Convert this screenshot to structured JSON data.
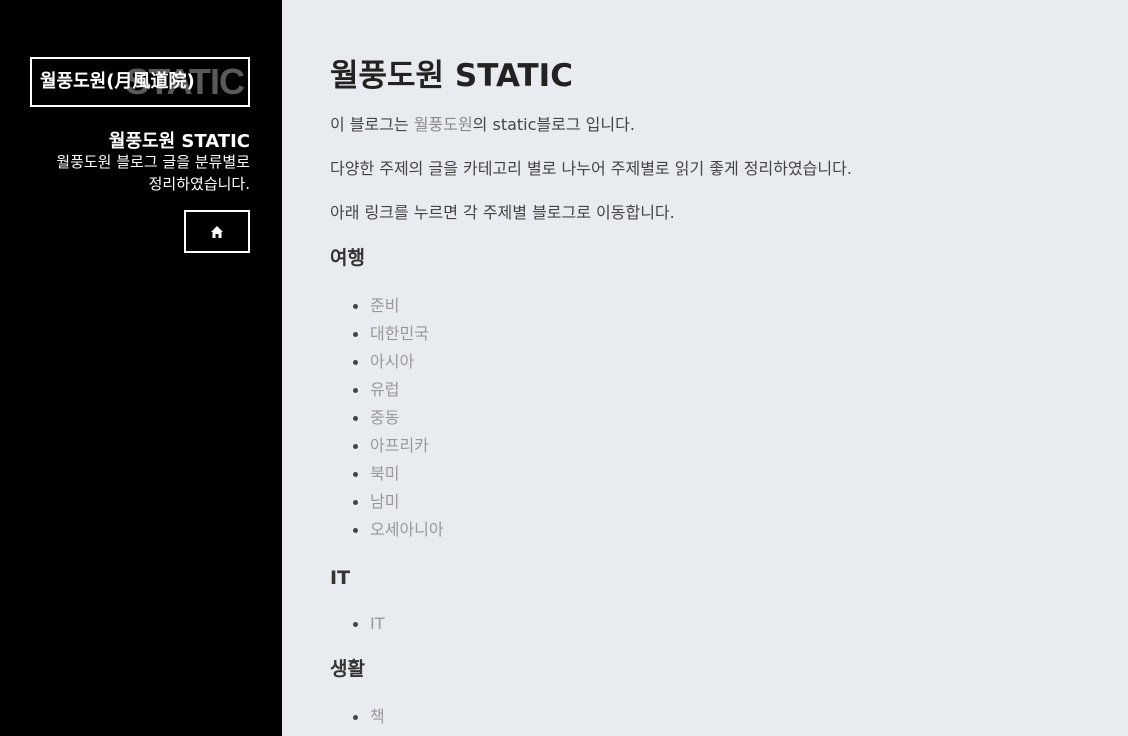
{
  "sidebar": {
    "logo_text": "월풍도원(月風道院)",
    "logo_overlay": "STATIC",
    "title": "월풍도원 STATIC",
    "description": "월풍도원 블로그 글을 분류별로 정리하였습니다.",
    "home_icon": "home-icon"
  },
  "main": {
    "title": "월풍도원 STATIC",
    "intro_prefix": "이 블로그는 ",
    "intro_link": "월풍도원",
    "intro_suffix": "의 static블로그 입니다.",
    "para2": "다양한 주제의 글을 카테고리 별로 나누어 주제별로 읽기 좋게 정리하였습니다.",
    "para3": "아래 링크를 누르면 각 주제별 블로그로 이동합니다.",
    "sections": [
      {
        "heading": "여행",
        "items": [
          "준비",
          "대한민국",
          "아시아",
          "유럽",
          "중동",
          "아프리카",
          "북미",
          "남미",
          "오세아니아"
        ]
      },
      {
        "heading": "IT",
        "items": [
          "IT"
        ]
      },
      {
        "heading": "생활",
        "items": [
          "책"
        ]
      }
    ]
  }
}
